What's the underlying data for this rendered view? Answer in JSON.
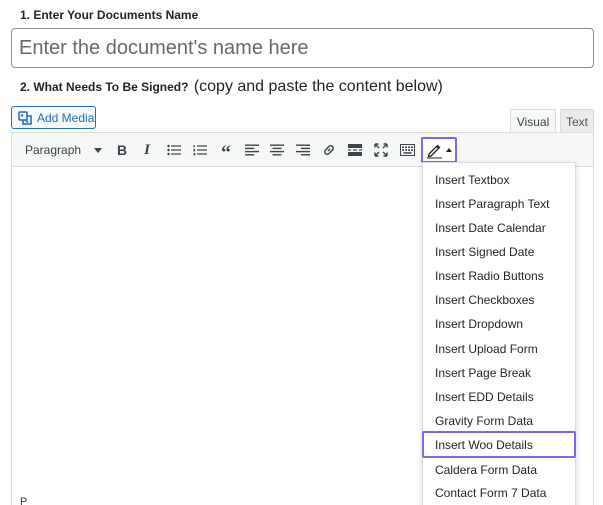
{
  "form": {
    "name_label": "1. Enter Your Documents Name",
    "name_placeholder": "Enter the document's name here",
    "content_label": "2. What Needs To Be Signed?",
    "content_note": "(copy and paste the content below)"
  },
  "editor": {
    "add_media_label": "Add Media",
    "tabs": {
      "visual": "Visual",
      "text": "Text"
    },
    "format_select": "Paragraph",
    "bold_glyph": "B",
    "italic_glyph": "I",
    "quote_glyph": "“",
    "status_path": "P"
  },
  "toolbar_icons": [
    "bold-icon",
    "italic-icon",
    "bullet-list-icon",
    "numbered-list-icon",
    "blockquote-icon",
    "align-left-icon",
    "align-center-icon",
    "align-right-icon",
    "link-icon",
    "read-more-icon",
    "fullscreen-icon",
    "toolbar-toggle-icon",
    "pencil-sign-icon"
  ],
  "dropdown": {
    "items": [
      "Insert Textbox",
      "Insert Paragraph Text",
      "Insert Date Calendar",
      "Insert Signed Date",
      "Insert Radio Buttons",
      "Insert Checkboxes",
      "Insert Dropdown",
      "Insert Upload Form",
      "Insert Page Break",
      "Insert EDD Details",
      "Gravity Form Data",
      "Insert Woo Details",
      "Caldera Form Data",
      "Contact Form 7 Data"
    ],
    "highlighted": "Insert Woo Details"
  },
  "colors": {
    "accent": "#2271b1",
    "highlight": "#7b68ee",
    "toolbar_bg": "#f6f7f7",
    "border": "#dcdcde"
  }
}
